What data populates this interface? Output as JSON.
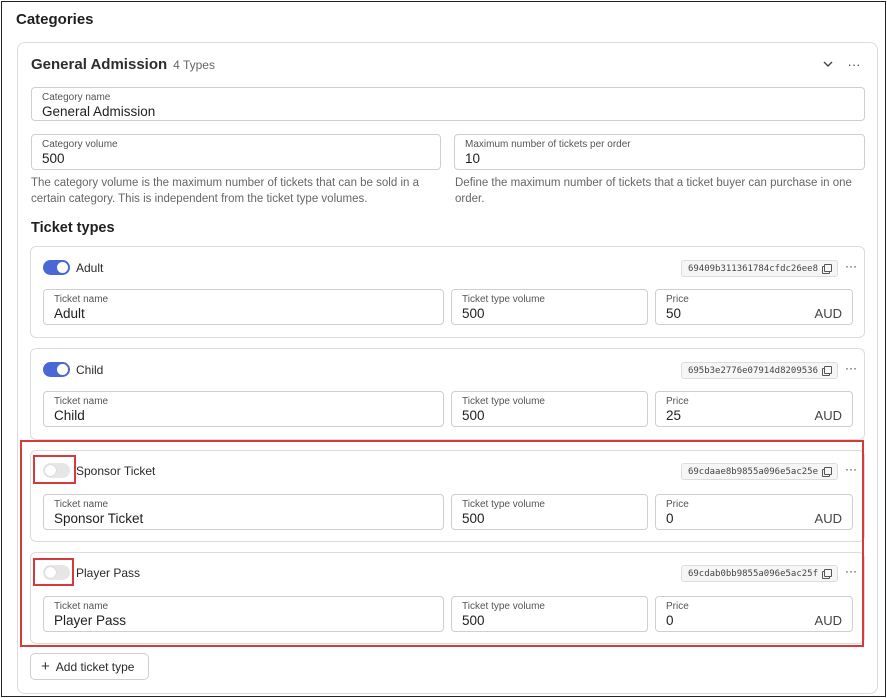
{
  "page": {
    "title": "Categories"
  },
  "category": {
    "name": "General Admission",
    "type_count": "4 Types",
    "icons": {
      "collapse": "chevron-down-icon",
      "more": "more-horizontal-icon"
    },
    "name_field": {
      "label": "Category name",
      "value": "General Admission"
    },
    "volume_field": {
      "label": "Category volume",
      "value": "500"
    },
    "max_field": {
      "label": "Maximum number of tickets per order",
      "value": "10"
    },
    "volume_help": "The category volume is the maximum number of tickets that can be sold in a certain category. This is independent from the ticket type volumes.",
    "max_help": "Define the maximum number of tickets that a ticket buyer can purchase in one order."
  },
  "ticket_types_title": "Ticket types",
  "tickets": [
    {
      "label": "Adult",
      "enabled": true,
      "id": "69409b311361784cfdc26ee8",
      "name_label": "Ticket name",
      "name": "Adult",
      "volume_label": "Ticket type volume",
      "volume": "500",
      "price_label": "Price",
      "price": "50",
      "currency": "AUD"
    },
    {
      "label": "Child",
      "enabled": true,
      "id": "695b3e2776e07914d8209536",
      "name_label": "Ticket name",
      "name": "Child",
      "volume_label": "Ticket type volume",
      "volume": "500",
      "price_label": "Price",
      "price": "25",
      "currency": "AUD"
    },
    {
      "label": "Sponsor Ticket",
      "enabled": false,
      "id": "69cdaae8b9855a096e5ac25e",
      "name_label": "Ticket name",
      "name": "Sponsor Ticket",
      "volume_label": "Ticket type volume",
      "volume": "500",
      "price_label": "Price",
      "price": "0",
      "currency": "AUD"
    },
    {
      "label": "Player Pass",
      "enabled": false,
      "id": "69cdab0bb9855a096e5ac25f",
      "name_label": "Ticket name",
      "name": "Player Pass",
      "volume_label": "Ticket type volume",
      "volume": "500",
      "price_label": "Price",
      "price": "0",
      "currency": "AUD"
    }
  ],
  "add_button": {
    "label": "Add ticket type",
    "icon": "plus-icon"
  },
  "colors": {
    "accent": "#4a67d6",
    "highlight": "#d63a3a",
    "toggle_off": "#e6e6e6"
  }
}
